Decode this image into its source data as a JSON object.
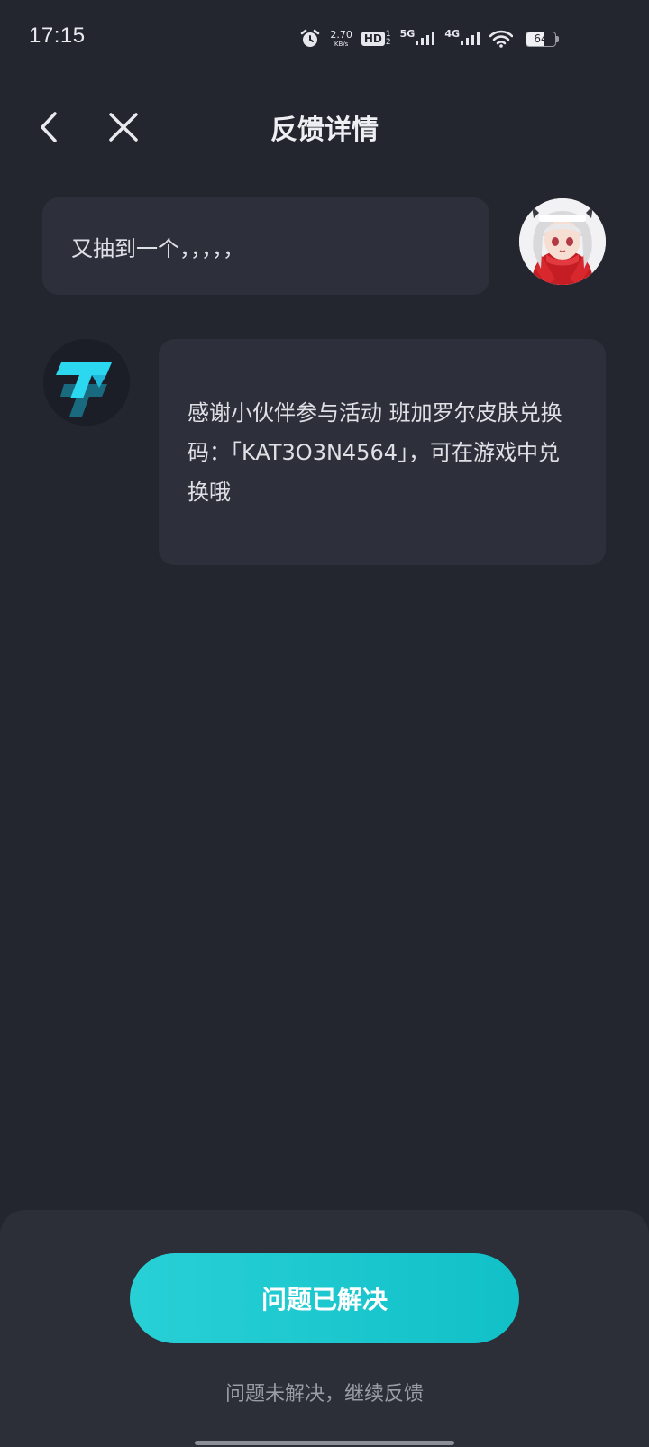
{
  "status_bar": {
    "time": "17:15",
    "net_speed_value": "2.70",
    "net_speed_unit": "KB/s",
    "hd_label": "HD",
    "hd_sub_top": "1",
    "hd_sub_bottom": "2",
    "network_1": "5G",
    "network_2": "4G",
    "battery_percent": "64",
    "icons": [
      "alarm-icon",
      "hd-icon",
      "signal-5g-icon",
      "signal-4g-icon",
      "wifi-icon",
      "battery-icon"
    ]
  },
  "header": {
    "title": "反馈详情",
    "back_icon": "chevron-left-icon",
    "close_icon": "close-icon"
  },
  "messages": {
    "user_text": "又抽到一个，，，，，",
    "bot_text": "感谢小伙伴参与活动 班加罗尔皮肤兑换码：「KAT3O3N4564」，可在游戏中兑换哦"
  },
  "bottom": {
    "resolved_label": "问题已解决",
    "continue_label": "问题未解决，继续反馈"
  },
  "colors": {
    "background": "#23252f",
    "bubble": "#2d2f3a",
    "accent": "#1fc8cf",
    "sheet": "#2c2e38"
  }
}
